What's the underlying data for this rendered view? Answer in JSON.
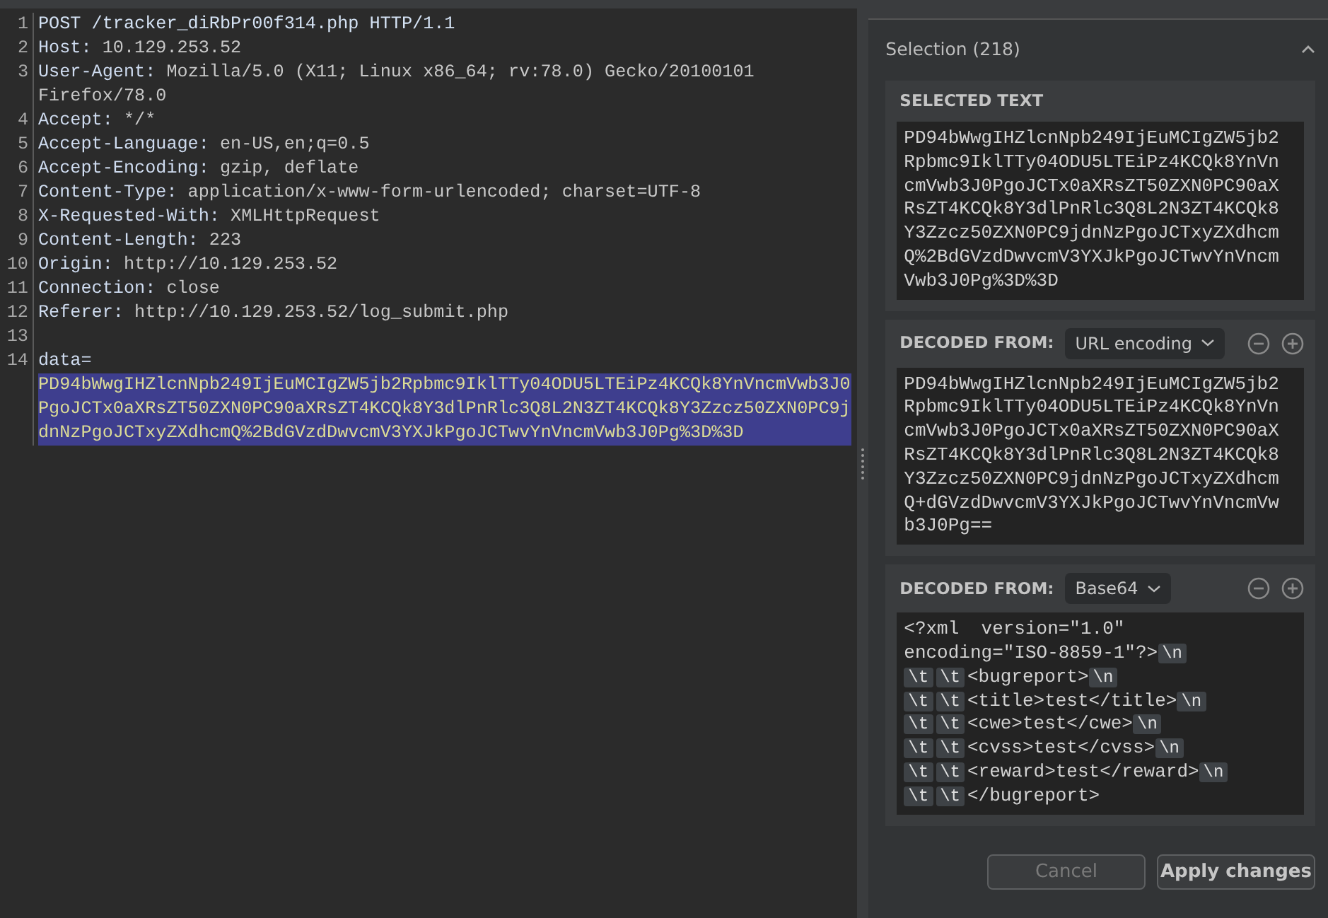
{
  "request_editor": {
    "lines": [
      {
        "number": "1",
        "segments": [
          {
            "kind": "request_line",
            "text": "POST /tracker_diRbPr00f314.php HTTP/1.1",
            "selected": false
          }
        ]
      },
      {
        "number": "2",
        "segments": [
          {
            "kind": "header_name",
            "text": "Host:",
            "selected": false
          },
          {
            "kind": "header_value",
            "text": " 10.129.253.52",
            "selected": false
          }
        ]
      },
      {
        "number": "3",
        "segments": [
          {
            "kind": "header_name",
            "text": "User-Agent:",
            "selected": false
          },
          {
            "kind": "header_value",
            "text": " Mozilla/5.0 (X11; Linux x86_64; rv:78.0) Gecko/20100101 Firefox/78.0",
            "selected": false
          }
        ]
      },
      {
        "number": "4",
        "segments": [
          {
            "kind": "header_name",
            "text": "Accept:",
            "selected": false
          },
          {
            "kind": "header_value",
            "text": " */*",
            "selected": false
          }
        ]
      },
      {
        "number": "5",
        "segments": [
          {
            "kind": "header_name",
            "text": "Accept-Language:",
            "selected": false
          },
          {
            "kind": "header_value",
            "text": " en-US,en;q=0.5",
            "selected": false
          }
        ]
      },
      {
        "number": "6",
        "segments": [
          {
            "kind": "header_name",
            "text": "Accept-Encoding:",
            "selected": false
          },
          {
            "kind": "header_value",
            "text": " gzip, deflate",
            "selected": false
          }
        ]
      },
      {
        "number": "7",
        "segments": [
          {
            "kind": "header_name",
            "text": "Content-Type:",
            "selected": false
          },
          {
            "kind": "header_value",
            "text": " application/x-www-form-urlencoded; charset=UTF-8",
            "selected": false
          }
        ]
      },
      {
        "number": "8",
        "segments": [
          {
            "kind": "header_name",
            "text": "X-Requested-With:",
            "selected": false
          },
          {
            "kind": "header_value",
            "text": " XMLHttpRequest",
            "selected": false
          }
        ]
      },
      {
        "number": "9",
        "segments": [
          {
            "kind": "header_name",
            "text": "Content-Length:",
            "selected": false
          },
          {
            "kind": "header_value",
            "text": " 223",
            "selected": false
          }
        ]
      },
      {
        "number": "10",
        "segments": [
          {
            "kind": "header_name",
            "text": "Origin:",
            "selected": false
          },
          {
            "kind": "header_value",
            "text": " http://10.129.253.52",
            "selected": false
          }
        ]
      },
      {
        "number": "11",
        "segments": [
          {
            "kind": "header_name",
            "text": "Connection:",
            "selected": false
          },
          {
            "kind": "header_value",
            "text": " close",
            "selected": false
          }
        ]
      },
      {
        "number": "12",
        "segments": [
          {
            "kind": "header_name",
            "text": "Referer:",
            "selected": false
          },
          {
            "kind": "header_value",
            "text": " http://10.129.253.52/log_submit.php",
            "selected": false
          }
        ]
      },
      {
        "number": "13"
      },
      {
        "number": "14",
        "segments": [
          {
            "kind": "body_name",
            "text": "data=",
            "selected": false
          },
          {
            "kind": "body_value",
            "text": "PD94bWwgIHZlcnNpb249IjEuMCIgZW5jb2Rpbmc9IklTTy04ODU5LTEiPz4KCQk8YnVncmVwb3J0PgoJCTx0aXRsZT50ZXN0PC90aXRsZT4KCQk8Y3dlPnRlc3Q8L2N3ZT4KCQk8Y3Zzcz50ZXN0PC9jdnNzPgoJCTxyZXdhcmQ%2BdGVzdDwvcmV3YXJkPgoJCTwvYnVncmVwb3J0Pg%3D%3D",
            "selected": true
          }
        ]
      }
    ]
  },
  "inspector": {
    "title": "Selection (218)",
    "expanded": true,
    "sections": [
      {
        "kind": "selected",
        "heading": "SELECTED TEXT",
        "content": "PD94bWwgIHZlcnNpb249IjEuMCIgZW5jb2Rpbmc9IklTTy04ODU5LTEiPz4KCQk8YnVncmVwb3J0PgoJCTx0aXRsZT50ZXN0PC90aXRsZT4KCQk8Y3dlPnRlc3Q8L2N3ZT4KCQk8Y3Zzcz50ZXN0PC9jdnNzPgoJCTxyZXdhcmQ%2BdGVzdDwvcmV3YXJkPgoJCTwvYnVncmVwb3J0Pg%3D%3D"
      },
      {
        "kind": "decoded",
        "heading": "DECODED FROM:",
        "decoder": "URL encoding",
        "content": "PD94bWwgIHZlcnNpb249IjEuMCIgZW5jb2Rpbmc9IklTTy04ODU5LTEiPz4KCQk8YnVncmVwb3J0PgoJCTx0aXRsZT50ZXN0PC90aXRsZT4KCQk8Y3dlPnRlc3Q8L2N3ZT4KCQk8Y3Zzcz50ZXN0PC9jdnNzPgoJCTxyZXdhcmQ+dGVzdDwvcmV3YXJkPgoJCTwvYnVncmVwb3J0Pg=="
      },
      {
        "kind": "decoded_tokens",
        "heading": "DECODED FROM:",
        "decoder": "Base64",
        "lines": [
          [
            {
              "kind": "text",
              "text": "<?xml  version=\"1.0\""
            }
          ],
          [
            {
              "kind": "text",
              "text": "encoding=\"ISO-8859-1\"?>"
            },
            {
              "kind": "escape",
              "text": "\\n"
            }
          ],
          [
            {
              "kind": "escape",
              "text": "\\t"
            },
            {
              "kind": "escape",
              "text": "\\t"
            },
            {
              "kind": "text",
              "text": "<bugreport>"
            },
            {
              "kind": "escape",
              "text": "\\n"
            }
          ],
          [
            {
              "kind": "escape",
              "text": "\\t"
            },
            {
              "kind": "escape",
              "text": "\\t"
            },
            {
              "kind": "text",
              "text": "<title>test</title>"
            },
            {
              "kind": "escape",
              "text": "\\n"
            }
          ],
          [
            {
              "kind": "escape",
              "text": "\\t"
            },
            {
              "kind": "escape",
              "text": "\\t"
            },
            {
              "kind": "text",
              "text": "<cwe>test</cwe>"
            },
            {
              "kind": "escape",
              "text": "\\n"
            }
          ],
          [
            {
              "kind": "escape",
              "text": "\\t"
            },
            {
              "kind": "escape",
              "text": "\\t"
            },
            {
              "kind": "text",
              "text": "<cvss>test</cvss>"
            },
            {
              "kind": "escape",
              "text": "\\n"
            }
          ],
          [
            {
              "kind": "escape",
              "text": "\\t"
            },
            {
              "kind": "escape",
              "text": "\\t"
            },
            {
              "kind": "text",
              "text": "<reward>test</reward>"
            },
            {
              "kind": "escape",
              "text": "\\n"
            }
          ],
          [
            {
              "kind": "escape",
              "text": "\\t"
            },
            {
              "kind": "escape",
              "text": "\\t"
            },
            {
              "kind": "text",
              "text": "</bugreport>"
            }
          ]
        ]
      }
    ],
    "buttons": [
      {
        "label": "Cancel",
        "disabled": true
      },
      {
        "label": "Apply changes",
        "disabled": false
      }
    ]
  }
}
